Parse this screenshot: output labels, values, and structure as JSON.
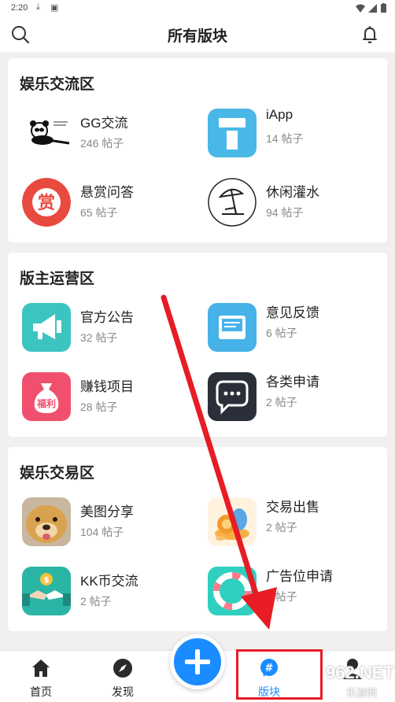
{
  "status_bar": {
    "time": "2:20",
    "icons": [
      "download-icon",
      "image-icon",
      "wifi-icon",
      "signal-icon",
      "battery-icon"
    ]
  },
  "header": {
    "title": "所有版块",
    "left_icon": "search-icon",
    "right_icon": "bell-icon"
  },
  "sections": [
    {
      "title": "娱乐交流区",
      "forums": [
        {
          "name": "GG交流",
          "count": "246 帖子",
          "icon": "panda-meme-icon"
        },
        {
          "name": "iApp",
          "count": "14 帖子",
          "icon": "iapp-logo-icon",
          "color": "#4ab8e6"
        },
        {
          "name": "悬赏问答",
          "count": "65 帖子",
          "icon": "reward-icon",
          "color": "#e94a3f",
          "icon_text": "赏"
        },
        {
          "name": "休闲灌水",
          "count": "94 帖子",
          "icon": "beach-umbrella-icon"
        }
      ]
    },
    {
      "title": "版主运营区",
      "forums": [
        {
          "name": "官方公告",
          "count": "32 帖子",
          "icon": "megaphone-icon",
          "color": "#3cc4c0"
        },
        {
          "name": "意见反馈",
          "count": "6 帖子",
          "icon": "mail-icon",
          "color": "#46b2e8"
        },
        {
          "name": "赚钱项目",
          "count": "28 帖子",
          "icon": "money-bag-icon",
          "color": "#f0506e",
          "icon_text": "福利"
        },
        {
          "name": "各类申请",
          "count": "2 帖子",
          "icon": "chat-bubble-icon",
          "color": "#2a2f3a"
        }
      ]
    },
    {
      "title": "娱乐交易区",
      "forums": [
        {
          "name": "美图分享",
          "count": "104 帖子",
          "icon": "dog-photo-icon"
        },
        {
          "name": "交易出售",
          "count": "2 帖子",
          "icon": "coins-icon"
        },
        {
          "name": "KK币交流",
          "count": "2 帖子",
          "icon": "handshake-icon",
          "color": "#2bb5a5"
        },
        {
          "name": "广告位申请",
          "count": "1 帖子",
          "icon": "lifebuoy-icon",
          "color": "#2fd0c0"
        }
      ]
    }
  ],
  "bottom_nav": {
    "items": [
      {
        "label": "首页",
        "icon": "home-icon"
      },
      {
        "label": "发现",
        "icon": "compass-icon"
      },
      {
        "label": "版块",
        "icon": "hashtag-icon",
        "active": true
      },
      {
        "label": "",
        "icon": "profile-icon"
      }
    ],
    "fab_icon": "plus-icon",
    "accent": "#1a8cff"
  },
  "watermark": {
    "main": "962.NET",
    "sub": "乐游网"
  },
  "annotation_color": "#e81c25"
}
